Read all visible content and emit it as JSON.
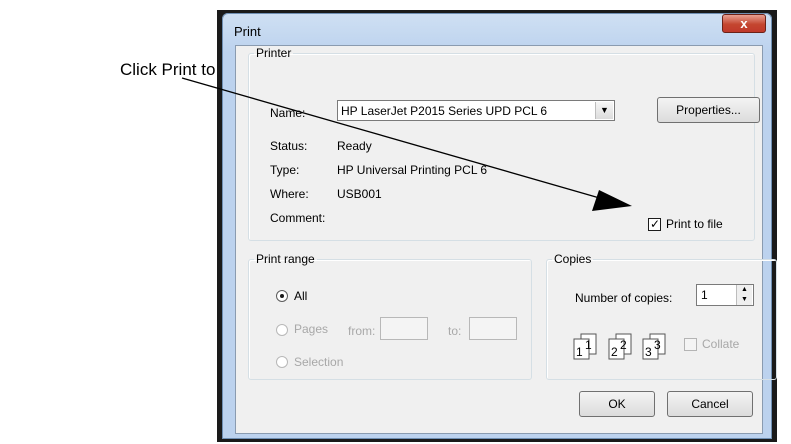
{
  "callout": {
    "text": "Click Print to file."
  },
  "dialog": {
    "title": "Print",
    "close_label": "x",
    "printer": {
      "legend": "Printer",
      "name_label": "Name:",
      "name_value": "HP LaserJet P2015 Series UPD PCL 6",
      "properties_label": "Properties...",
      "status_label": "Status:",
      "status_value": "Ready",
      "type_label": "Type:",
      "type_value": "HP Universal Printing PCL 6",
      "where_label": "Where:",
      "where_value": "USB001",
      "comment_label": "Comment:",
      "print_to_file_label": "Print to file",
      "print_to_file_checked": true
    },
    "print_range": {
      "legend": "Print range",
      "all_label": "All",
      "pages_label": "Pages",
      "from_label": "from:",
      "to_label": "to:",
      "selection_label": "Selection",
      "selected": "All"
    },
    "copies": {
      "legend": "Copies",
      "number_label": "Number of copies:",
      "number_value": "1",
      "collate_label": "Collate",
      "collate_checked": false,
      "icon_labels": [
        "1",
        "1",
        "2",
        "2",
        "3",
        "3"
      ]
    },
    "ok_label": "OK",
    "cancel_label": "Cancel"
  }
}
